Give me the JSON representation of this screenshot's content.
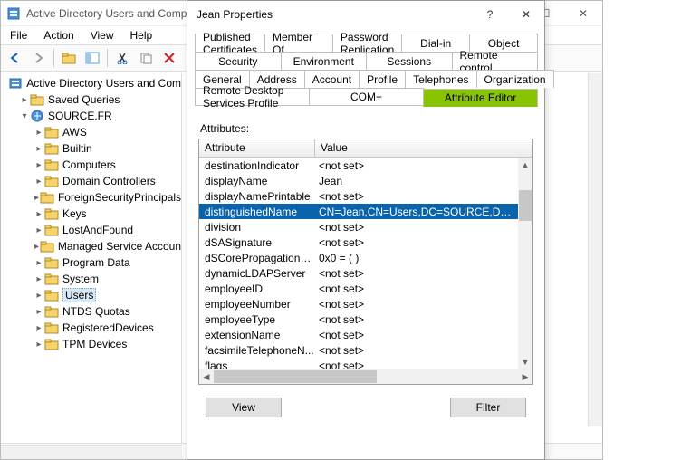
{
  "window": {
    "title": "Active Directory Users and Comp"
  },
  "menu": [
    "File",
    "Action",
    "View",
    "Help"
  ],
  "tree": {
    "root_label": "Active Directory Users and Com",
    "saved_queries_label": "Saved Queries",
    "domain_label": "SOURCE.FR",
    "nodes": [
      "AWS",
      "Builtin",
      "Computers",
      "Domain Controllers",
      "ForeignSecurityPrincipals",
      "Keys",
      "LostAndFound",
      "Managed Service Accoun",
      "Program Data",
      "System",
      "Users",
      "NTDS Quotas",
      "RegisteredDevices",
      "TPM Devices"
    ],
    "selected": "Users"
  },
  "dialog": {
    "title": "Jean Properties",
    "tabs_row1": [
      "Published Certificates",
      "Member Of",
      "Password Replication",
      "Dial-in",
      "Object"
    ],
    "tabs_row2": [
      "Security",
      "Environment",
      "Sessions",
      "Remote control"
    ],
    "tabs_row3": [
      "General",
      "Address",
      "Account",
      "Profile",
      "Telephones",
      "Organization"
    ],
    "tabs_row4": [
      "Remote Desktop Services Profile",
      "COM+",
      "Attribute Editor"
    ],
    "active_tab": "Attribute Editor",
    "attributes_label": "Attributes:",
    "col_attribute": "Attribute",
    "col_value": "Value",
    "rows": [
      {
        "a": "destinationIndicator",
        "v": "<not set>"
      },
      {
        "a": "displayName",
        "v": "Jean"
      },
      {
        "a": "displayNamePrintable",
        "v": "<not set>"
      },
      {
        "a": "distinguishedName",
        "v": "CN=Jean,CN=Users,DC=SOURCE,DC=FR"
      },
      {
        "a": "division",
        "v": "<not set>"
      },
      {
        "a": "dSASignature",
        "v": "<not set>"
      },
      {
        "a": "dSCorePropagationD...",
        "v": "0x0 = (  )"
      },
      {
        "a": "dynamicLDAPServer",
        "v": "<not set>"
      },
      {
        "a": "employeeID",
        "v": "<not set>"
      },
      {
        "a": "employeeNumber",
        "v": "<not set>"
      },
      {
        "a": "employeeType",
        "v": "<not set>"
      },
      {
        "a": "extensionName",
        "v": "<not set>"
      },
      {
        "a": "facsimileTelephoneN...",
        "v": "<not set>"
      },
      {
        "a": "flags",
        "v": "<not set>"
      }
    ],
    "selected_row_index": 3,
    "view_button": "View",
    "filter_button": "Filter"
  }
}
